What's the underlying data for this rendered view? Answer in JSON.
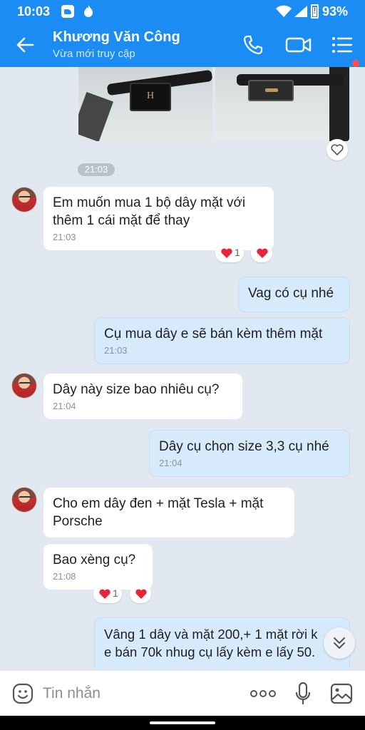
{
  "status_bar": {
    "time": "10:03",
    "battery": "93%"
  },
  "header": {
    "contact_name": "Khương Văn Công",
    "contact_status": "Vừa mới truy cập",
    "accent_color": "#1a8cf3"
  },
  "conversation": {
    "time_separator": "21:03",
    "messages": [
      {
        "direction": "incoming",
        "text_lines": [
          "Em muốn mua 1 bộ dây mặt với",
          "thêm 1 cái mặt để thay"
        ],
        "time": "21:03",
        "reaction_count": "1"
      },
      {
        "direction": "outgoing",
        "text_lines": [
          "Vag có cụ nhé"
        ],
        "time": ""
      },
      {
        "direction": "outgoing",
        "text_lines": [
          "Cụ mua dây e sẽ bán kèm thêm mặt"
        ],
        "time": "21:03"
      },
      {
        "direction": "incoming",
        "text_lines": [
          "Dây này size bao nhiêu cụ?"
        ],
        "time": "21:04"
      },
      {
        "direction": "outgoing",
        "text_lines": [
          "Dây cụ chọn size 3,3 cụ nhé"
        ],
        "time": "21:04"
      },
      {
        "direction": "incoming",
        "text_lines": [
          "Cho em dây đen + mặt Tesla + mặt",
          "Porsche"
        ],
        "time": ""
      },
      {
        "direction": "incoming",
        "text_lines": [
          "Bao xèng cụ?"
        ],
        "time": "21:08",
        "reaction_count": "1"
      },
      {
        "direction": "outgoing",
        "text_lines": [
          "Vâng 1 dây và mặt 200,+ 1 mặt rời k",
          "e bán 70k nhug cụ lấy kèm e lấy 50."
        ],
        "time": ""
      }
    ]
  },
  "composer": {
    "placeholder": "Tin nhắn"
  }
}
